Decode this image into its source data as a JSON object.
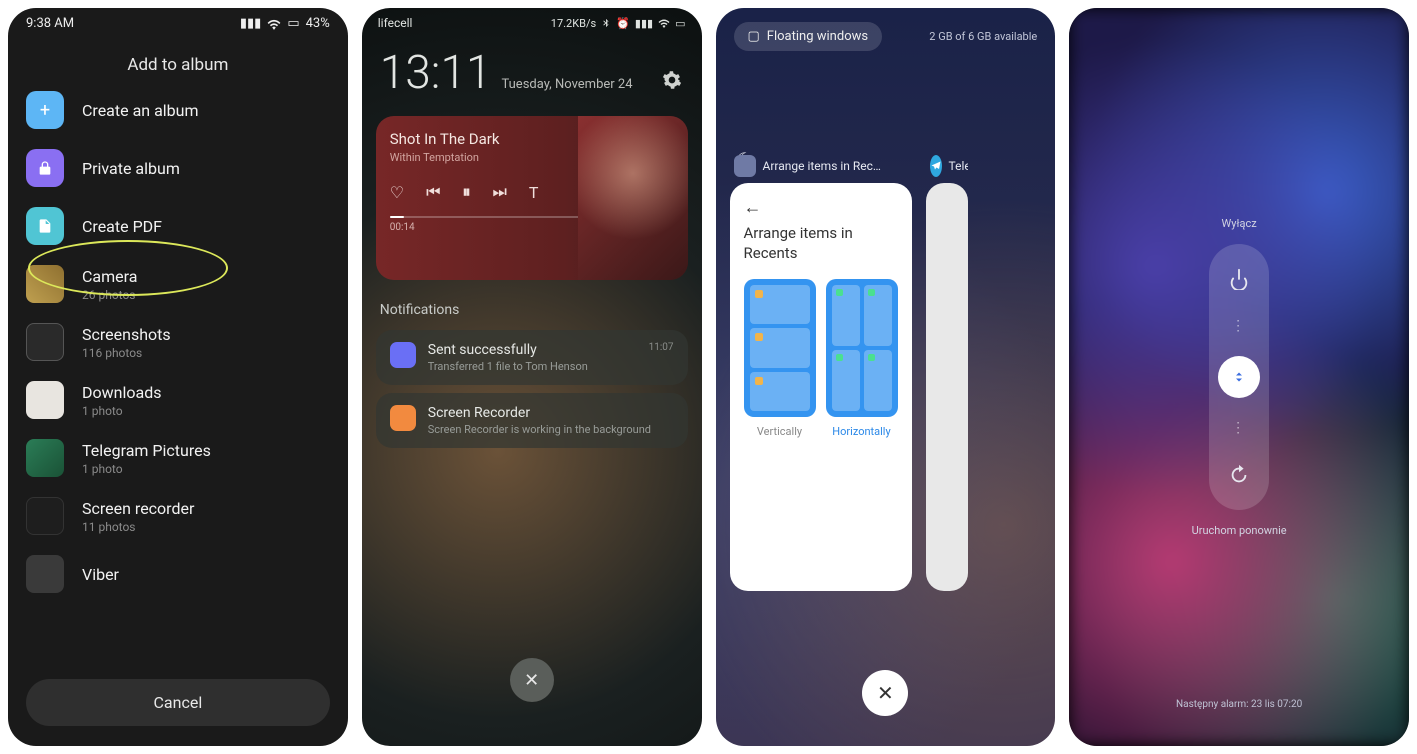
{
  "phone1": {
    "status_time": "9:38 AM",
    "status_battery": "43%",
    "title": "Add to album",
    "actions": {
      "create_album": "Create an album",
      "private_album": "Private album",
      "create_pdf": "Create PDF"
    },
    "albums": [
      {
        "name": "Camera",
        "sub": "26 photos"
      },
      {
        "name": "Screenshots",
        "sub": "116 photos"
      },
      {
        "name": "Downloads",
        "sub": "1 photo"
      },
      {
        "name": "Telegram Pictures",
        "sub": "1 photo"
      },
      {
        "name": "Screen recorder",
        "sub": "11 photos"
      },
      {
        "name": "Viber",
        "sub": ""
      }
    ],
    "cancel": "Cancel"
  },
  "phone2": {
    "carrier": "lifecell",
    "speed": "17.2KB/s",
    "time": "13:11",
    "date": "Tuesday, November 24",
    "music": {
      "song": "Shot In The Dark",
      "artist": "Within Temptation",
      "elapsed": "00:14"
    },
    "notifications_label": "Notifications",
    "notifs": [
      {
        "title": "Sent successfully",
        "sub": "Transferred 1 file to Tom Henson",
        "time": "11:07"
      },
      {
        "title": "Screen Recorder",
        "sub": "Screen Recorder is working in the background",
        "time": ""
      }
    ]
  },
  "phone3": {
    "floating": "Floating windows",
    "memory": "2 GB of 6 GB available",
    "apps": [
      {
        "label": "Arrange items in Rec…"
      },
      {
        "label": "Teleg…"
      }
    ],
    "card": {
      "title": "Arrange items in Recents",
      "opt_v": "Vertically",
      "opt_h": "Horizontally"
    }
  },
  "phone4": {
    "top": "Wyłącz",
    "bottom": "Uruchom ponownie",
    "alarm": "Następny alarm: 23 lis 07:20"
  }
}
